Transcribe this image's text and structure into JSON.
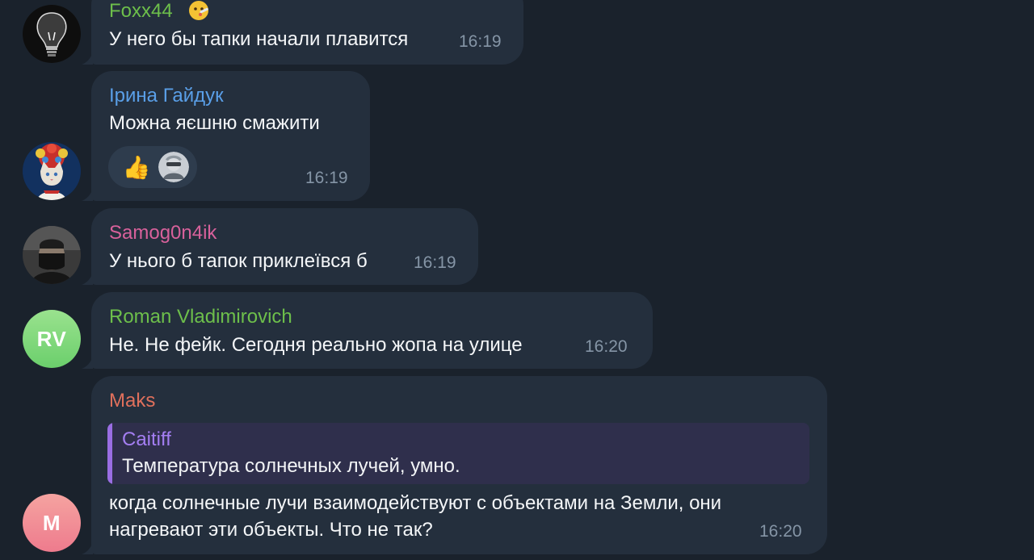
{
  "colors": {
    "background": "#1a222c",
    "bubble": "#242f3d",
    "time": "#8595a6",
    "quote_bg": "#2f2f4c",
    "quote_bar": "#9a6ee3"
  },
  "messages": [
    {
      "sender": "Foxx44",
      "sender_color": "#6dbf4b",
      "badge_icon": "face-with-thermometer-emoji",
      "text": "У него бы тапки начали плавится",
      "time": "16:19",
      "avatar_icon": "lightbulb-avatar"
    },
    {
      "sender": "Ірина Гайдук",
      "sender_color": "#5a9fe8",
      "text": "Можна яєшню смажити",
      "time": "16:19",
      "avatar_icon": "cat-wreath-avatar",
      "reactions": [
        {
          "icon": "thumbs-up-emoji",
          "glyph": "👍"
        },
        {
          "icon": "reactor-user-avatar"
        }
      ]
    },
    {
      "sender": "Samog0n4ik",
      "sender_color": "#d8619b",
      "text": "У нього б тапок приклеївся б",
      "time": "16:19",
      "avatar_icon": "masked-person-avatar"
    },
    {
      "sender": "Roman Vladimirovich",
      "sender_color": "#6dbf4b",
      "text": "Не. Не фейк. Сегодня реально жопа на улице",
      "time": "16:20",
      "avatar_initials": "RV",
      "avatar_color": "#7ed87c"
    },
    {
      "sender": "Maks",
      "sender_color": "#e0705c",
      "reply": {
        "sender": "Caitiff",
        "sender_color": "#a47ef2",
        "text": "Температура солнечных лучей, умно."
      },
      "text_lines": [
        "когда солнечные лучи взаимодействуют с объектами на Земли, они",
        "нагревают эти объекты. Что не так?"
      ],
      "time": "16:20",
      "avatar_initials": "M",
      "avatar_color": "#f07d8c"
    }
  ]
}
